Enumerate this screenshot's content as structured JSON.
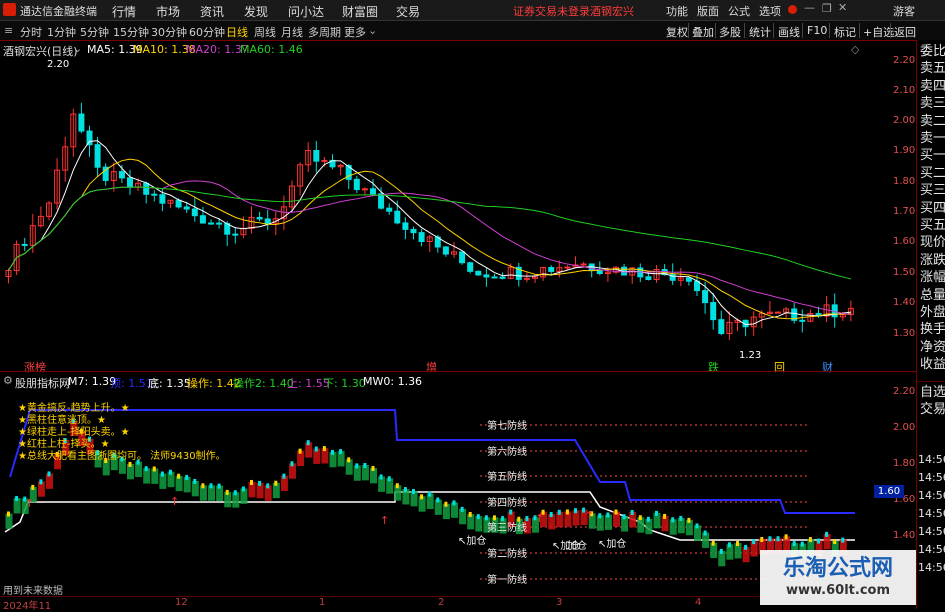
{
  "app": {
    "title": "通达信金融终端",
    "top_menu": [
      "行情",
      "市场",
      "资讯",
      "发现",
      "问小达",
      "财富圈",
      "交易"
    ],
    "warning": "证券交易未登录",
    "stock_tag": "酒钢宏兴",
    "right_menu": [
      "功能",
      "版面",
      "公式",
      "选项"
    ],
    "user": "游客"
  },
  "toolbar": {
    "periods": [
      "分时",
      "1分钟",
      "5分钟",
      "15分钟",
      "30分钟",
      "60分钟",
      "日线",
      "周线",
      "月线",
      "多周期",
      "更多"
    ],
    "active_period": "日线",
    "right_buttons": [
      "复权",
      "叠加",
      "多股",
      "统计",
      "画线",
      "F10",
      "标记",
      "+自选",
      "返回"
    ]
  },
  "main_chart": {
    "stock_name": "酒钢宏兴(日线)",
    "ma_labels": [
      {
        "label": "MA5: 1.39",
        "color": "#ffffff"
      },
      {
        "label": "MA10: 1.38",
        "color": "#ffd400"
      },
      {
        "label": "MA20: 1.37",
        "color": "#d040d0"
      },
      {
        "label": "MA60: 1.46",
        "color": "#20d020"
      }
    ],
    "y_ticks": [
      "2.20",
      "2.10",
      "2.00",
      "1.90",
      "1.80",
      "1.70",
      "1.60",
      "1.50",
      "1.40",
      "1.30"
    ],
    "high_label": "2.20",
    "low_label": "1.23",
    "markers": [
      {
        "text": "涨榜",
        "color": "#ff4040"
      },
      {
        "text": "增",
        "color": "#ff4040"
      },
      {
        "text": "跌",
        "color": "#20d020"
      },
      {
        "text": "回",
        "color": "#ffd400"
      },
      {
        "text": "财",
        "color": "#4090ff"
      }
    ]
  },
  "sub_chart": {
    "indicator_name": "股朋指标网",
    "values": [
      {
        "label": "M7: 1.39",
        "color": "#ffffff"
      },
      {
        "label": "顶: 1.51",
        "color": "#2a2aff"
      },
      {
        "label": "底: 1.35",
        "color": "#ffffff"
      },
      {
        "label": "操作: 1.42",
        "color": "#ffd400"
      },
      {
        "label": "操作2: 1.40",
        "color": "#20d020"
      },
      {
        "label": "上: 1.55",
        "color": "#d040d0"
      },
      {
        "label": "下: 1.30",
        "color": "#20d020"
      },
      {
        "label": "MW0: 1.36",
        "color": "#ffffff"
      }
    ],
    "notes": [
      "黄金搞反-趋势上升。",
      "黑柱住意逃顶。",
      "绿柱走上-择阳头卖。",
      "红柱上柱-择买。",
      "总线大肥看主图浙图均可。 法师9430制作。"
    ],
    "defense_lines": [
      "第七防线",
      "第六防线",
      "第五防线",
      "第四防线",
      "第三防线",
      "第二防线",
      "第一防线"
    ],
    "add_labels": [
      "加仓",
      "加仓",
      "加仓",
      "加仓"
    ],
    "y_ticks": [
      "2.20",
      "2.00",
      "1.80",
      "1.60",
      "1.40"
    ],
    "current_value": "1.60",
    "footnote": "用到未来数据"
  },
  "sidebar": {
    "items_top": [
      "委比",
      "卖五",
      "卖四",
      "卖三",
      "卖二",
      "卖一",
      "买一",
      "买二",
      "买三",
      "买四",
      "买五",
      "现价",
      "涨跌",
      "涨幅",
      "总量",
      "外盘",
      "换手",
      "净资",
      "收益"
    ],
    "items_bottom": [
      "自选",
      "交易"
    ],
    "times": [
      "14:56",
      "14:56",
      "14:56",
      "14:56",
      "14:56",
      "14:56",
      "14:56"
    ]
  },
  "x_axis": [
    "2024年11",
    "12",
    "1",
    "2",
    "3",
    "4"
  ],
  "watermark": {
    "title": "乐淘公式网",
    "url": "www.60lt.com"
  },
  "colors": {
    "up": "#ff3333",
    "down": "#00e0e0",
    "bg": "#000000",
    "accent": "#7a0000"
  }
}
